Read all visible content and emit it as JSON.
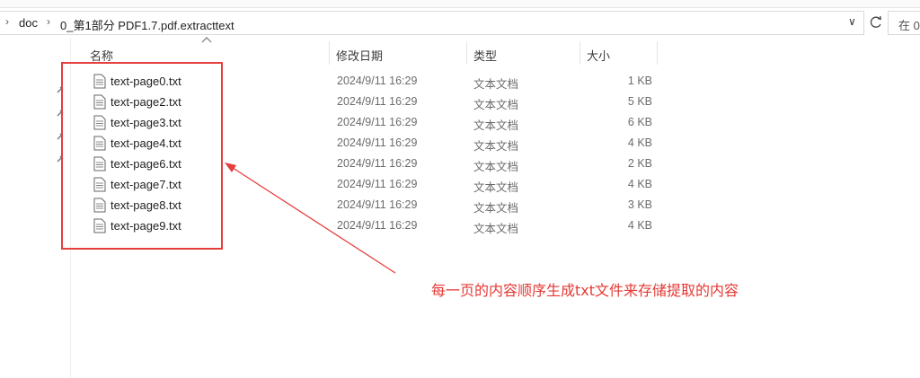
{
  "breadcrumb": {
    "items": [
      "doc",
      "0_第1部分 PDF1.7.pdf.extracttext"
    ]
  },
  "search": {
    "text": "在 0"
  },
  "columns": {
    "name": "名称",
    "date": "修改日期",
    "type": "类型",
    "size": "大小"
  },
  "files": [
    {
      "name": "text-page0.txt",
      "date": "2024/9/11 16:29",
      "type": "文本文档",
      "size": "1 KB"
    },
    {
      "name": "text-page2.txt",
      "date": "2024/9/11 16:29",
      "type": "文本文档",
      "size": "5 KB"
    },
    {
      "name": "text-page3.txt",
      "date": "2024/9/11 16:29",
      "type": "文本文档",
      "size": "6 KB"
    },
    {
      "name": "text-page4.txt",
      "date": "2024/9/11 16:29",
      "type": "文本文档",
      "size": "4 KB"
    },
    {
      "name": "text-page6.txt",
      "date": "2024/9/11 16:29",
      "type": "文本文档",
      "size": "2 KB"
    },
    {
      "name": "text-page7.txt",
      "date": "2024/9/11 16:29",
      "type": "文本文档",
      "size": "4 KB"
    },
    {
      "name": "text-page8.txt",
      "date": "2024/9/11 16:29",
      "type": "文本文档",
      "size": "3 KB"
    },
    {
      "name": "text-page9.txt",
      "date": "2024/9/11 16:29",
      "type": "文本文档",
      "size": "4 KB"
    }
  ],
  "annotation": {
    "text": "每一页的内容顺序生成txt文件来存储提取的内容"
  },
  "colors": {
    "annotation_red": "#e63d3d"
  }
}
